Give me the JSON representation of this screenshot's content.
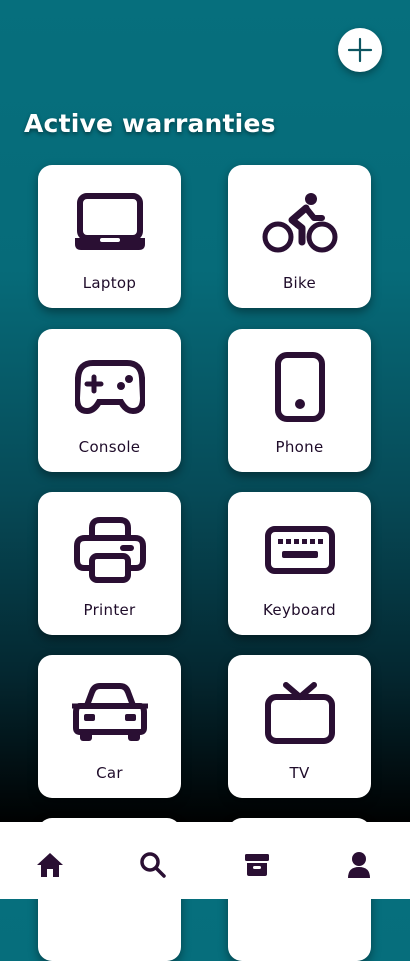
{
  "header": {
    "add_button_icon": "plus-icon"
  },
  "title": "Active warranties",
  "items": [
    {
      "label": "Laptop",
      "icon": "laptop-icon"
    },
    {
      "label": "Bike",
      "icon": "bike-icon"
    },
    {
      "label": "Console",
      "icon": "gamepad-icon"
    },
    {
      "label": "Phone",
      "icon": "phone-icon"
    },
    {
      "label": "Printer",
      "icon": "printer-icon"
    },
    {
      "label": "Keyboard",
      "icon": "keyboard-icon"
    },
    {
      "label": "Car",
      "icon": "car-icon"
    },
    {
      "label": "TV",
      "icon": "tv-icon"
    }
  ],
  "bottom_nav": [
    {
      "icon": "home-icon"
    },
    {
      "icon": "search-icon"
    },
    {
      "icon": "archive-icon"
    },
    {
      "icon": "user-icon"
    }
  ],
  "colors": {
    "accent": "#066f7d",
    "icon_dark": "#2a0f33",
    "card": "#ffffff"
  }
}
